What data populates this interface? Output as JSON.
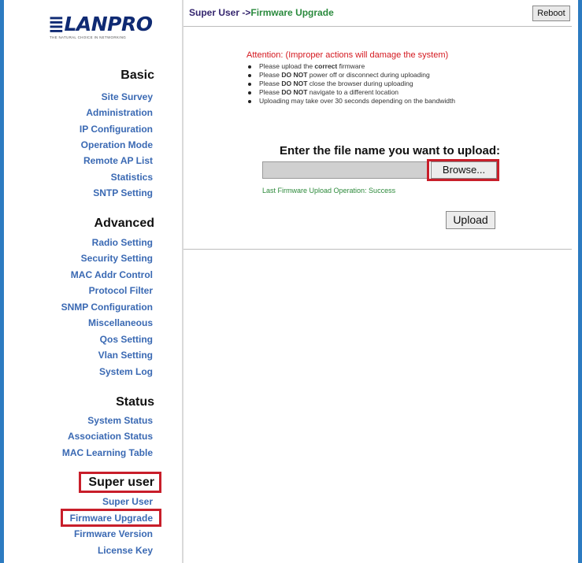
{
  "logo": {
    "text": "≣LANPRO",
    "tagline": "THE NATURAL CHOICE IN NETWORKING"
  },
  "nav": {
    "basic": {
      "title": "Basic",
      "items": [
        "Site Survey",
        "Administration",
        "IP Configuration",
        "Operation Mode",
        "Remote AP List",
        "Statistics",
        "SNTP Setting"
      ]
    },
    "advanced": {
      "title": "Advanced",
      "items": [
        "Radio Setting",
        "Security Setting",
        "MAC Addr Control",
        "Protocol Filter",
        "SNMP Configuration",
        "Miscellaneous",
        "Qos Setting",
        "Vlan Setting",
        "System Log"
      ]
    },
    "status": {
      "title": "Status",
      "items": [
        "System Status",
        "Association Status",
        "MAC Learning Table"
      ]
    },
    "superuser": {
      "title": "Super user",
      "items": [
        "Super User",
        "Firmware Upgrade",
        "Firmware Version",
        "License Key"
      ]
    }
  },
  "header": {
    "breadcrumb_prefix": "Super User ->",
    "breadcrumb_current": "Firmware Upgrade",
    "reboot_label": "Reboot"
  },
  "attention": {
    "title": "Attention: (Improper actions will damage the system)",
    "items": [
      {
        "pre": "Please upload the ",
        "bold": "correct",
        "post": " firmware"
      },
      {
        "pre": "Please ",
        "bold": "DO NOT",
        "post": " power off or disconnect during uploading"
      },
      {
        "pre": "Please ",
        "bold": "DO NOT",
        "post": " close the browser during uploading"
      },
      {
        "pre": "Please ",
        "bold": "DO NOT",
        "post": " navigate to a different location"
      },
      {
        "pre": "Uploading may take over 30 seconds depending on the bandwidth",
        "bold": "",
        "post": ""
      }
    ]
  },
  "upload": {
    "heading": "Enter the file name you want to upload:",
    "file_value": "",
    "browse_label": "Browse...",
    "last_operation": "Last Firmware Upload Operation: Success",
    "upload_label": "Upload"
  },
  "colors": {
    "frame": "#2c7bc1",
    "nav_link": "#3a69b3",
    "highlight": "#c81e2a",
    "attention": "#d4181f",
    "success": "#2d8a3b"
  }
}
